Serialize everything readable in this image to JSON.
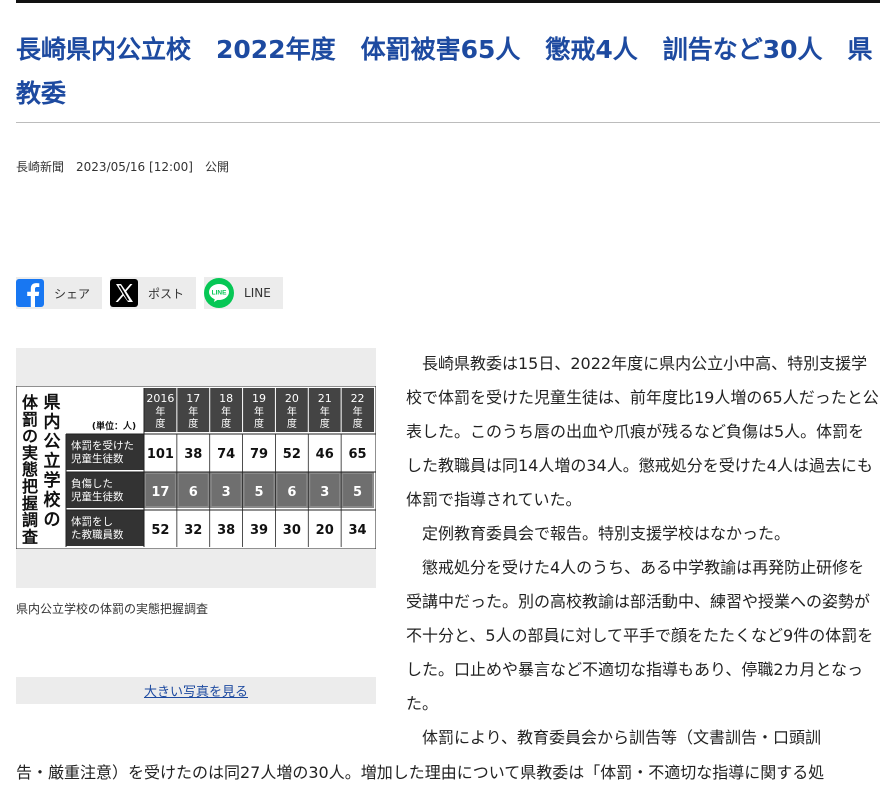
{
  "article": {
    "headline": "長崎県内公立校　2022年度　体罰被害65人　懲戒4人　訓告など30人　県教委",
    "source": "長崎新聞",
    "datetime": "2023/05/16 [12:00]",
    "published_label": "公開"
  },
  "share": {
    "facebook_label": "シェア",
    "x_label": "ポスト",
    "line_label": "LINE",
    "line_logo_text": "LINE"
  },
  "photo": {
    "table_title": "県内公立学校の体罰の実態把握調査",
    "unit": "(単位：人)",
    "years": [
      "2016年度",
      "17年度",
      "18年度",
      "19年度",
      "20年度",
      "21年度",
      "22年度"
    ],
    "rows": [
      {
        "label": "体罰を受けた児童生徒数",
        "values": [
          "101",
          "38",
          "74",
          "79",
          "52",
          "46",
          "65"
        ]
      },
      {
        "label": "負傷した児童生徒数",
        "values": [
          "17",
          "6",
          "3",
          "5",
          "6",
          "3",
          "5"
        ]
      },
      {
        "label": "体罰をした教職員数",
        "values": [
          "52",
          "32",
          "38",
          "39",
          "30",
          "20",
          "34"
        ]
      }
    ],
    "caption": "県内公立学校の体罰の実態把握調査",
    "big_photo_link": "大きい写真を見る"
  },
  "body": {
    "p1": "長崎県教委は15日、2022年度に県内公立小中高、特別支援学校で体罰を受けた児童生徒は、前年度比19人増の65人だったと公表した。このうち唇の出血や爪痕が残るなど負傷は5人。体罰をした教職員は同14人増の34人。懲戒処分を受けた4人は過去にも体罰で指導されていた。",
    "p2": "定例教育委員会で報告。特別支援学校はなかった。",
    "p3": "懲戒処分を受けた4人のうち、ある中学教諭は再発防止研修を受講中だった。別の高校教諭は部活動中、練習や授業への姿勢が不十分と、5人の部員に対して平手で顔をたたくなど9件の体罰をした。口止めや暴言など不適切な指導もあり、停職2カ月となった。",
    "p4_start": "体罰により、教育委員会から訓告等（文書訓告・口頭訓",
    "p4_rest": "告・厳重注意）を受けたのは同27人増の30人。増加した理由について県教委は「体罰・不適切な指導に関する処"
  }
}
